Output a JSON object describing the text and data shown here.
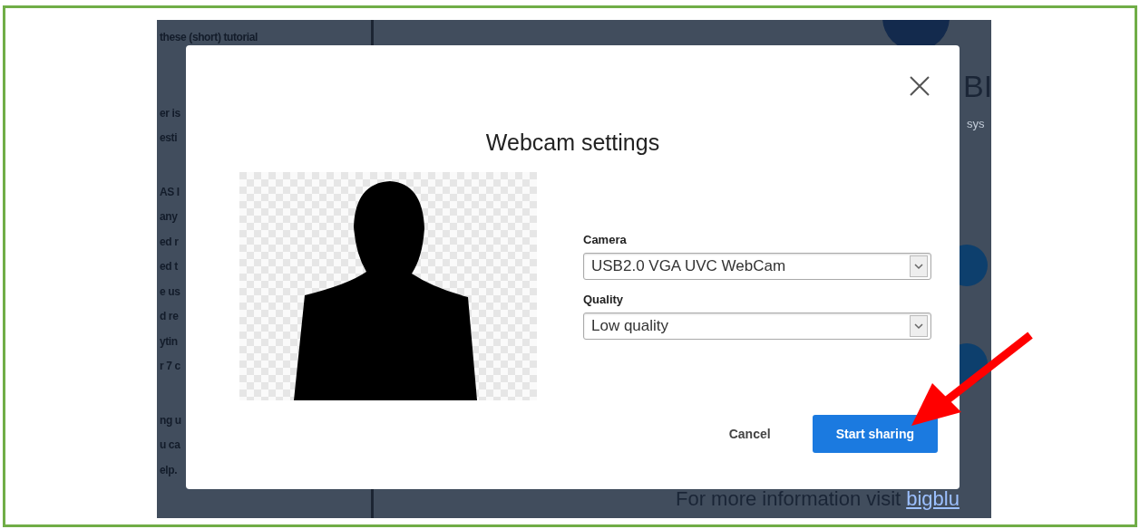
{
  "background": {
    "paragraphs": [
      [
        "these (short) tutorial"
      ],
      [
        "er is",
        "esti"
      ],
      [
        "AS I",
        "any",
        "ed r",
        "ed t",
        "e us",
        "d re",
        "ytin",
        "r 7 c"
      ],
      [
        "ng u",
        "u ca",
        "elp."
      ]
    ],
    "heading": "BI",
    "subheading": "sys",
    "footer_text": "For more information visit",
    "footer_link": "bigblu"
  },
  "dialog": {
    "title": "Webcam settings",
    "fields": [
      {
        "label": "Camera",
        "value": "USB2.0 VGA UVC WebCam"
      },
      {
        "label": "Quality",
        "value": "Low quality"
      }
    ],
    "buttons": [
      {
        "label": "Cancel",
        "kind": "secondary"
      },
      {
        "label": "Start sharing",
        "kind": "primary"
      }
    ]
  }
}
